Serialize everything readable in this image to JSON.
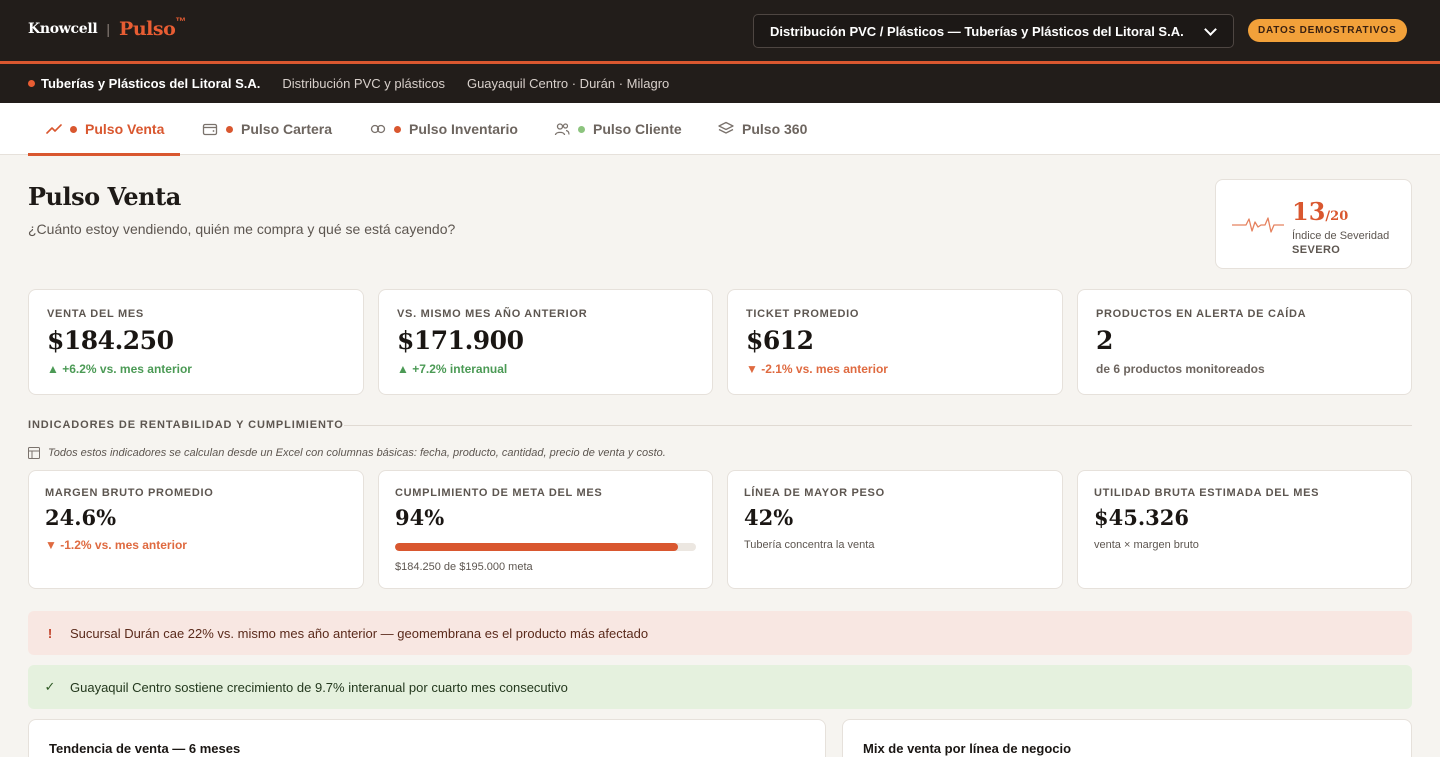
{
  "brand": {
    "company": "Knowcell",
    "separator": "|",
    "product": "Pulso",
    "tm": "™"
  },
  "header": {
    "company_selector": "Distribución PVC / Plásticos — Tuberías y Plásticos del Litoral S.A.",
    "demo_badge": "DATOS DEMOSTRATIVOS"
  },
  "subbar": {
    "company_name": "Tuberías y Plásticos del Litoral S.A.",
    "industry": "Distribución PVC y plásticos",
    "locations": "Guayaquil Centro · Durán · Milagro"
  },
  "tabs": [
    {
      "label": "Pulso Venta",
      "icon": "trend-line-icon",
      "dot": "#d9572f",
      "active": true
    },
    {
      "label": "Pulso Cartera",
      "icon": "wallet-icon",
      "dot": "#d9572f",
      "active": false
    },
    {
      "label": "Pulso Inventario",
      "icon": "infinity-icon",
      "dot": "#d9572f",
      "active": false
    },
    {
      "label": "Pulso Cliente",
      "icon": "users-icon",
      "dot": "#8cc47e",
      "active": false
    },
    {
      "label": "Pulso 360",
      "icon": "layers-icon",
      "dot": "",
      "active": false
    }
  ],
  "page": {
    "title": "Pulso Venta",
    "subtitle": "¿Cuánto estoy vendiendo, quién me compra y qué se está cayendo?"
  },
  "severity": {
    "score": "13",
    "denominator": "/20",
    "label": "Índice de Severidad",
    "level": "SEVERO"
  },
  "kpis": [
    {
      "label": "VENTA DEL MES",
      "value": "$184.250",
      "delta": "▲ +6.2% vs. mes anterior",
      "trend": "up"
    },
    {
      "label": "VS. MISMO MES AÑO ANTERIOR",
      "value": "$171.900",
      "delta": "▲ +7.2% interanual",
      "trend": "up"
    },
    {
      "label": "TICKET PROMEDIO",
      "value": "$612",
      "delta": "▼ -2.1% vs. mes anterior",
      "trend": "down"
    },
    {
      "label": "PRODUCTOS EN ALERTA DE CAÍDA",
      "value": "2",
      "delta": "de 6 productos monitoreados",
      "trend": "neutral"
    }
  ],
  "section": {
    "title": "INDICADORES DE RENTABILIDAD Y CUMPLIMIENTO",
    "note": "Todos estos indicadores se calculan desde un Excel con columnas básicas: fecha, producto, cantidad, precio de venta y costo."
  },
  "indicators": {
    "margin": {
      "label": "MARGEN BRUTO PROMEDIO",
      "value": "24.6%",
      "delta": "▼ -1.2% vs. mes anterior"
    },
    "goal": {
      "label": "CUMPLIMIENTO DE META DEL MES",
      "value": "94%",
      "progress": 94,
      "note": "$184.250 de $195.000 meta"
    },
    "line": {
      "label": "LÍNEA DE MAYOR PESO",
      "value": "42%",
      "note": "Tubería concentra la venta"
    },
    "profit": {
      "label": "UTILIDAD BRUTA ESTIMADA DEL MES",
      "value": "$45.326",
      "note": "venta × margen bruto"
    }
  },
  "alerts": {
    "danger": {
      "icon": "!",
      "text": "Sucursal Durán cae 22% vs. mismo mes año anterior — geomembrana es el producto más afectado"
    },
    "success": {
      "icon": "✓",
      "text": "Guayaquil Centro sostiene crecimiento de 9.7% interanual por cuarto mes consecutivo"
    }
  },
  "bottom": {
    "trend_title": "Tendencia de venta — 6 meses",
    "mix_title": "Mix de venta por línea de negocio"
  },
  "colors": {
    "accent": "#d9572f",
    "dark": "#221d1a",
    "up": "#4b9a55",
    "down": "#df6a40",
    "badge": "#f2a13a"
  }
}
